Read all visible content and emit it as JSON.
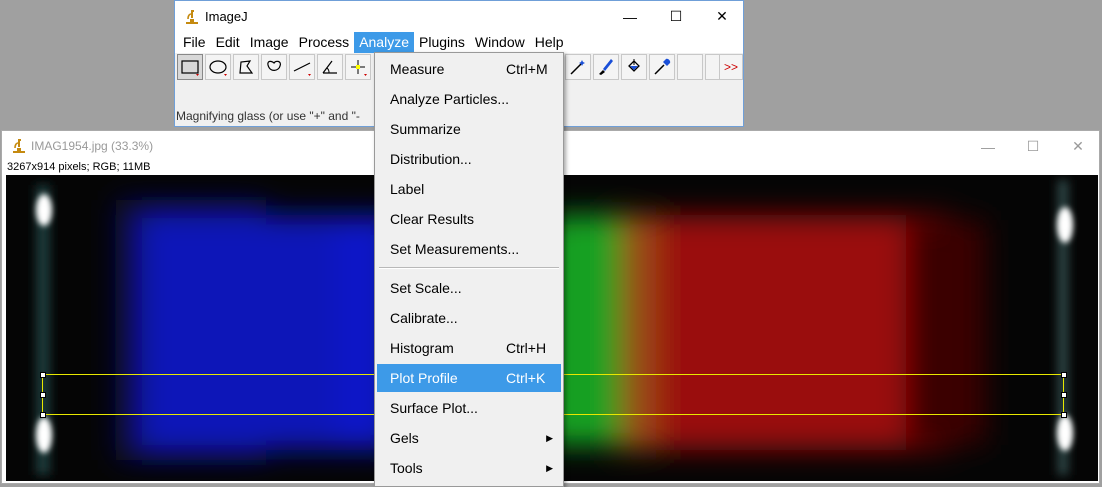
{
  "ij_window": {
    "title": "ImageJ",
    "controls": {
      "minimize": "—",
      "maximize": "☐",
      "close": "✕"
    },
    "menu": [
      "File",
      "Edit",
      "Image",
      "Process",
      "Analyze",
      "Plugins",
      "Window",
      "Help"
    ],
    "active_menu": "Analyze",
    "toolbar_more": ">>",
    "status": "Magnifying glass (or use \"+\" and \"-"
  },
  "image_window": {
    "title": "IMAG1954.jpg (33.3%)",
    "info": "3267x914 pixels; RGB; 11MB",
    "controls": {
      "minimize": "—",
      "maximize": "☐",
      "close": "✕"
    }
  },
  "analyze_menu": {
    "items": [
      {
        "label": "Measure",
        "shortcut": "Ctrl+M"
      },
      {
        "label": "Analyze Particles...",
        "shortcut": ""
      },
      {
        "label": "Summarize",
        "shortcut": ""
      },
      {
        "label": "Distribution...",
        "shortcut": ""
      },
      {
        "label": "Label",
        "shortcut": ""
      },
      {
        "label": "Clear Results",
        "shortcut": ""
      },
      {
        "label": "Set Measurements...",
        "shortcut": ""
      },
      {
        "label": "Set Scale...",
        "shortcut": ""
      },
      {
        "label": "Calibrate...",
        "shortcut": ""
      },
      {
        "label": "Histogram",
        "shortcut": "Ctrl+H"
      },
      {
        "label": "Plot Profile",
        "shortcut": "Ctrl+K"
      },
      {
        "label": "Surface Plot...",
        "shortcut": ""
      },
      {
        "label": "Gels",
        "shortcut": "",
        "submenu": true
      },
      {
        "label": "Tools",
        "shortcut": "",
        "submenu": true
      }
    ],
    "highlighted": "Plot Profile"
  },
  "colors": {
    "accent": "#3d9ae8",
    "roi": "#e8e800",
    "canvas_bg": "#050505"
  }
}
